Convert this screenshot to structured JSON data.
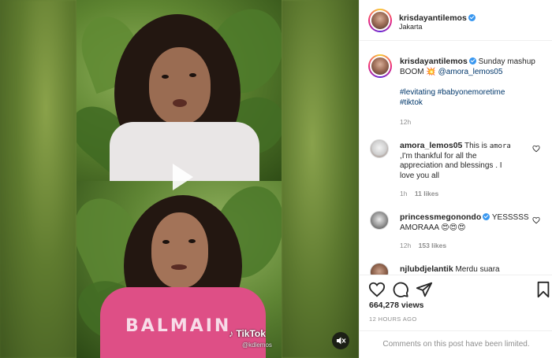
{
  "media": {
    "watermark_brand": "TikTok",
    "watermark_user": "@kdlemos",
    "shirt_text": "BALMAIN",
    "play_icon": "play-icon",
    "mute_icon": "speaker-mute-icon"
  },
  "header": {
    "username": "krisdayantilemos",
    "location": "Jakarta"
  },
  "caption": {
    "username": "krisdayantilemos",
    "text": "Sunday mashup BOOM",
    "emoji": "💥",
    "mention": "@amora_lemos05",
    "hashtags_line1": "#levitating #babyonemoretime",
    "hashtags_line2": "#tiktok",
    "time": "12h"
  },
  "comments": [
    {
      "username": "amora_lemos05",
      "text_line1": "This is",
      "text_mono": "amora",
      "text_line2": ",I'm thankful for all the",
      "text_line3": "appreciation and blessings . I",
      "text_line4": "love you all",
      "time": "1h",
      "likes": "11 likes"
    },
    {
      "username": "princessmegonondo",
      "text_line1": "YESSSSS",
      "text_line2": "AMORAAA 😍😍😍",
      "time": "12h",
      "likes": "153 likes"
    },
    {
      "username": "njlubdjelantik",
      "text_line1": "Merdu suara"
    }
  ],
  "actions": {
    "like_icon": "heart-icon",
    "comment_icon": "comment-icon",
    "share_icon": "share-icon",
    "save_icon": "bookmark-icon",
    "views": "664,278 views",
    "ago": "12 HOURS AGO",
    "limited": "Comments on this post have been limited."
  },
  "colors": {
    "verified": "#3897f0",
    "link": "#00376b",
    "muted": "#8e8e8e"
  }
}
